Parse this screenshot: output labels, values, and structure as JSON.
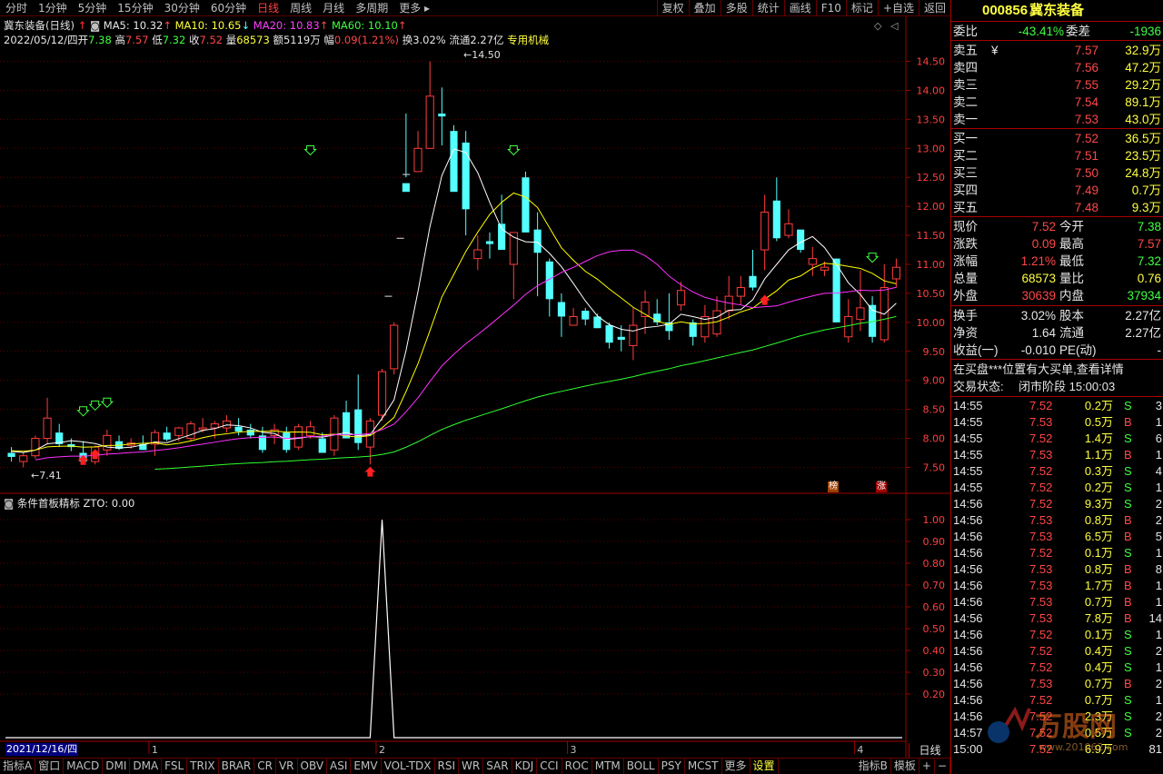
{
  "period_tabs": [
    "分时",
    "1分钟",
    "5分钟",
    "15分钟",
    "30分钟",
    "60分钟",
    "日线",
    "周线",
    "月线",
    "多周期",
    "更多"
  ],
  "active_period": "日线",
  "right_tools": [
    "复权",
    "叠加",
    "多股",
    "统计",
    "画线",
    "F10",
    "标记",
    "+自选",
    "返回"
  ],
  "chart": {
    "title": "冀东装备(日线)",
    "ma5": "MA5: 10.32",
    "ma10": "MA10: 10.65",
    "ma20": "MA20: 10.83",
    "ma60": "MA60: 10.10",
    "info_date": "2022/05/12/四",
    "info_open_label": "开",
    "info_open": "7.38",
    "info_high_label": "高",
    "info_high": "7.57",
    "info_low_label": "低",
    "info_low": "7.32",
    "info_close_label": "收",
    "info_close": "7.52",
    "info_vol_label": "量",
    "info_vol": "68573",
    "info_amt_label": "额",
    "info_amt": "5119万",
    "info_chg_label": "幅",
    "info_chg": "0.09(1.21%)",
    "info_turn_label": "换",
    "info_turn": "3.02%",
    "info_float_label": "流通",
    "info_float": "2.27亿",
    "info_sector": "专用机械",
    "high_mark": "14.50",
    "low_mark": "7.41",
    "badge_bang": "榜",
    "badge_zhang": "涨"
  },
  "indicator": {
    "title": "条件首板精标",
    "zto": "ZTO: 0.00"
  },
  "chart_data": {
    "type": "candlestick",
    "price_axis_ticks": [
      "7.50",
      "8.00",
      "8.50",
      "9.00",
      "9.50",
      "10.00",
      "10.50",
      "11.00",
      "11.50",
      "12.00",
      "12.50",
      "13.00",
      "13.50",
      "14.00",
      "14.50"
    ],
    "indicator_axis_ticks": [
      "0.20",
      "0.30",
      "0.40",
      "0.50",
      "0.60",
      "0.70",
      "0.80",
      "0.90",
      "1.00"
    ],
    "ylim": [
      7.1,
      14.9
    ],
    "indicator_ylim": [
      0,
      1.05
    ],
    "x_labels": [
      "2021/12/16/四",
      "1",
      "2",
      "3",
      "4"
    ],
    "x_label_index": [
      0,
      12,
      31,
      47,
      71
    ],
    "candles": [
      [
        7.75,
        7.85,
        7.6,
        7.68
      ],
      [
        7.6,
        7.75,
        7.5,
        7.7
      ],
      [
        7.7,
        8.05,
        7.65,
        8.0
      ],
      [
        8.0,
        8.7,
        7.9,
        8.35
      ],
      [
        8.1,
        8.25,
        7.85,
        7.9
      ],
      [
        7.9,
        8.0,
        7.78,
        7.85
      ],
      [
        7.75,
        7.95,
        7.55,
        7.6
      ],
      [
        7.6,
        7.88,
        7.55,
        7.85
      ],
      [
        7.8,
        8.15,
        7.7,
        8.05
      ],
      [
        7.95,
        8.05,
        7.8,
        7.82
      ],
      [
        7.88,
        8.0,
        7.82,
        7.92
      ],
      [
        7.9,
        8.05,
        7.8,
        7.8
      ],
      [
        7.9,
        8.15,
        7.7,
        8.1
      ],
      [
        8.1,
        8.2,
        7.95,
        7.98
      ],
      [
        8.05,
        8.2,
        7.95,
        8.18
      ],
      [
        8.0,
        8.3,
        7.95,
        8.25
      ],
      [
        8.15,
        8.35,
        8.1,
        8.18
      ],
      [
        8.18,
        8.3,
        8.0,
        8.25
      ],
      [
        8.18,
        8.4,
        8.1,
        8.3
      ],
      [
        8.2,
        8.35,
        8.05,
        8.12
      ],
      [
        8.15,
        8.25,
        8.0,
        8.05
      ],
      [
        8.05,
        8.2,
        7.75,
        7.8
      ],
      [
        8.05,
        8.25,
        7.9,
        8.15
      ],
      [
        8.1,
        8.2,
        7.75,
        7.8
      ],
      [
        7.85,
        8.25,
        7.8,
        8.2
      ],
      [
        8.05,
        8.3,
        8.0,
        8.2
      ],
      [
        8.0,
        8.1,
        7.75,
        7.75
      ],
      [
        7.8,
        8.4,
        7.7,
        8.35
      ],
      [
        8.45,
        8.65,
        8.2,
        8.0
      ],
      [
        8.5,
        9.1,
        7.8,
        7.92
      ],
      [
        7.85,
        8.35,
        7.55,
        8.3
      ],
      [
        8.4,
        9.2,
        8.3,
        9.15
      ],
      [
        9.2,
        10.0,
        9.1,
        9.95
      ],
      [
        12.4,
        13.6,
        12.5,
        12.25
      ],
      [
        12.6,
        13.3,
        12.8,
        13.0
      ],
      [
        13.0,
        14.5,
        13.7,
        13.9
      ],
      [
        13.6,
        14.05,
        13.05,
        13.55
      ],
      [
        13.3,
        13.4,
        12.35,
        12.25
      ],
      [
        13.1,
        13.3,
        11.5,
        11.95
      ],
      [
        11.1,
        11.5,
        10.9,
        11.25
      ],
      [
        11.4,
        11.55,
        11.1,
        11.35
      ],
      [
        11.7,
        12.2,
        11.7,
        11.25
      ],
      [
        11.0,
        11.5,
        10.4,
        11.55
      ],
      [
        12.5,
        12.6,
        11.7,
        11.55
      ],
      [
        11.6,
        11.9,
        10.45,
        11.2
      ],
      [
        11.05,
        11.1,
        10.1,
        10.4
      ],
      [
        10.35,
        10.5,
        9.75,
        10.1
      ],
      [
        9.95,
        10.25,
        9.95,
        10.1
      ],
      [
        10.2,
        10.25,
        9.95,
        10.05
      ],
      [
        10.1,
        10.15,
        9.9,
        9.9
      ],
      [
        9.95,
        10.0,
        9.55,
        9.65
      ],
      [
        9.75,
        9.95,
        9.5,
        9.7
      ],
      [
        9.6,
        10.25,
        9.35,
        9.95
      ],
      [
        10.1,
        10.55,
        9.8,
        10.35
      ],
      [
        10.15,
        10.4,
        9.95,
        10.0
      ],
      [
        10.0,
        10.5,
        9.7,
        9.85
      ],
      [
        10.3,
        10.7,
        10.2,
        10.55
      ],
      [
        10.0,
        10.05,
        9.6,
        9.75
      ],
      [
        9.75,
        10.3,
        9.65,
        10.1
      ],
      [
        9.8,
        10.45,
        9.75,
        10.2
      ],
      [
        10.2,
        10.8,
        10.05,
        10.45
      ],
      [
        10.45,
        10.8,
        10.3,
        10.6
      ],
      [
        10.8,
        11.25,
        10.55,
        10.6
      ],
      [
        11.25,
        12.2,
        10.9,
        11.9
      ],
      [
        12.1,
        12.5,
        11.4,
        11.45
      ],
      [
        11.5,
        11.95,
        11.45,
        11.7
      ],
      [
        11.6,
        11.55,
        11.2,
        11.25
      ],
      [
        11.0,
        11.3,
        10.8,
        11.1
      ],
      [
        10.9,
        11.05,
        10.8,
        10.95
      ],
      [
        11.1,
        11.1,
        10.0,
        10.0
      ],
      [
        9.75,
        10.4,
        9.65,
        10.1
      ],
      [
        10.05,
        10.9,
        9.85,
        10.25
      ],
      [
        10.3,
        10.45,
        9.65,
        9.75
      ],
      [
        9.7,
        11.0,
        9.65,
        10.6
      ],
      [
        10.75,
        11.1,
        10.6,
        10.95
      ]
    ],
    "indicator_spike_index": 31,
    "indicator_values": "0 everywhere except 1.00 at the spike"
  },
  "side": {
    "code": "000856",
    "name": "冀东装备",
    "weibi_label": "委比",
    "weibi": "-43.41%",
    "weicha_label": "委差",
    "weicha": "-1936",
    "asks": [
      {
        "label": "卖五",
        "mark": "¥",
        "price": "7.57",
        "vol": "32.9万"
      },
      {
        "label": "卖四",
        "mark": "",
        "price": "7.56",
        "vol": "47.2万"
      },
      {
        "label": "卖三",
        "mark": "",
        "price": "7.55",
        "vol": "29.2万"
      },
      {
        "label": "卖二",
        "mark": "",
        "price": "7.54",
        "vol": "89.1万"
      },
      {
        "label": "卖一",
        "mark": "",
        "price": "7.53",
        "vol": "43.0万"
      }
    ],
    "bids": [
      {
        "label": "买一",
        "price": "7.52",
        "vol": "36.5万"
      },
      {
        "label": "买二",
        "price": "7.51",
        "vol": "23.5万"
      },
      {
        "label": "买三",
        "price": "7.50",
        "vol": "24.8万"
      },
      {
        "label": "买四",
        "price": "7.49",
        "vol": "0.7万"
      },
      {
        "label": "买五",
        "price": "7.48",
        "vol": "9.3万"
      }
    ],
    "stats": [
      {
        "l1": "现价",
        "v1": "7.52",
        "c1": "red",
        "l2": "今开",
        "v2": "7.38",
        "c2": "green"
      },
      {
        "l1": "涨跌",
        "v1": "0.09",
        "c1": "red",
        "l2": "最高",
        "v2": "7.57",
        "c2": "red"
      },
      {
        "l1": "涨幅",
        "v1": "1.21%",
        "c1": "red",
        "l2": "最低",
        "v2": "7.32",
        "c2": "green"
      },
      {
        "l1": "总量",
        "v1": "68573",
        "c1": "yellow",
        "l2": "量比",
        "v2": "0.76",
        "c2": "yellow"
      },
      {
        "l1": "外盘",
        "v1": "30639",
        "c1": "red",
        "l2": "内盘",
        "v2": "37934",
        "c2": "green"
      },
      {
        "l1": "换手",
        "v1": "3.02%",
        "c1": "white",
        "l2": "股本",
        "v2": "2.27亿",
        "c2": "white"
      },
      {
        "l1": "净资",
        "v1": "1.64",
        "c1": "white",
        "l2": "流通",
        "v2": "2.27亿",
        "c2": "white"
      },
      {
        "l1": "收益(一)",
        "v1": "-0.010",
        "c1": "white",
        "l2": "PE(动)",
        "v2": "-",
        "c2": "white"
      }
    ],
    "notice": "在买盘***位置有大买单,查看详情",
    "status_label": "交易状态:",
    "status_value": "闭市阶段 15:00:03",
    "ticks": [
      {
        "t": "14:55",
        "p": "7.52",
        "v": "0.2万",
        "d": "S",
        "n": "3"
      },
      {
        "t": "14:55",
        "p": "7.53",
        "v": "0.5万",
        "d": "B",
        "n": "1"
      },
      {
        "t": "14:55",
        "p": "7.52",
        "v": "1.4万",
        "d": "S",
        "n": "6"
      },
      {
        "t": "14:55",
        "p": "7.53",
        "v": "1.1万",
        "d": "B",
        "n": "1"
      },
      {
        "t": "14:55",
        "p": "7.52",
        "v": "0.3万",
        "d": "S",
        "n": "4"
      },
      {
        "t": "14:55",
        "p": "7.52",
        "v": "0.2万",
        "d": "S",
        "n": "1"
      },
      {
        "t": "14:56",
        "p": "7.52",
        "v": "9.3万",
        "d": "S",
        "n": "2"
      },
      {
        "t": "14:56",
        "p": "7.53",
        "v": "0.8万",
        "d": "B",
        "n": "2"
      },
      {
        "t": "14:56",
        "p": "7.53",
        "v": "6.5万",
        "d": "B",
        "n": "5"
      },
      {
        "t": "14:56",
        "p": "7.52",
        "v": "0.1万",
        "d": "S",
        "n": "1"
      },
      {
        "t": "14:56",
        "p": "7.53",
        "v": "0.8万",
        "d": "B",
        "n": "8"
      },
      {
        "t": "14:56",
        "p": "7.53",
        "v": "1.7万",
        "d": "B",
        "n": "1"
      },
      {
        "t": "14:56",
        "p": "7.53",
        "v": "0.7万",
        "d": "B",
        "n": "1"
      },
      {
        "t": "14:56",
        "p": "7.53",
        "v": "7.8万",
        "d": "B",
        "n": "14"
      },
      {
        "t": "14:56",
        "p": "7.52",
        "v": "0.1万",
        "d": "S",
        "n": "1"
      },
      {
        "t": "14:56",
        "p": "7.52",
        "v": "0.4万",
        "d": "S",
        "n": "2"
      },
      {
        "t": "14:56",
        "p": "7.52",
        "v": "0.4万",
        "d": "S",
        "n": "1"
      },
      {
        "t": "14:56",
        "p": "7.53",
        "v": "0.7万",
        "d": "B",
        "n": "2"
      },
      {
        "t": "14:56",
        "p": "7.52",
        "v": "0.7万",
        "d": "S",
        "n": "1"
      },
      {
        "t": "14:56",
        "p": "7.52",
        "v": "2.3万",
        "d": "S",
        "n": "2"
      },
      {
        "t": "14:57",
        "p": "7.52",
        "v": "0.5万",
        "d": "S",
        "n": "2"
      },
      {
        "t": "15:00",
        "p": "7.52",
        "v": "6.9万",
        "d": "",
        "n": "81"
      }
    ]
  },
  "bottom_tabs": [
    "指标A",
    "窗口",
    "MACD",
    "DMI",
    "DMA",
    "FSL",
    "TRIX",
    "BRAR",
    "CR",
    "VR",
    "OBV",
    "ASI",
    "EMV",
    "VOL-TDX",
    "RSI",
    "WR",
    "SAR",
    "KDJ",
    "CCI",
    "ROC",
    "MTM",
    "BOLL",
    "PSY",
    "MCST",
    "更多",
    "设置"
  ],
  "bottom_tabs_right": [
    "指标B",
    "模板",
    "+",
    "−"
  ],
  "bottom_date": "2021/12/16/四",
  "bottom_period": "日线",
  "watermark": "www.201062.com",
  "colors": {
    "up": "#ff3c3c",
    "down": "#54ffff",
    "ma5": "#ffffff",
    "ma10": "#ffff00",
    "ma20": "#ff30ff",
    "ma60": "#30ff30",
    "grid": "#a00000"
  }
}
